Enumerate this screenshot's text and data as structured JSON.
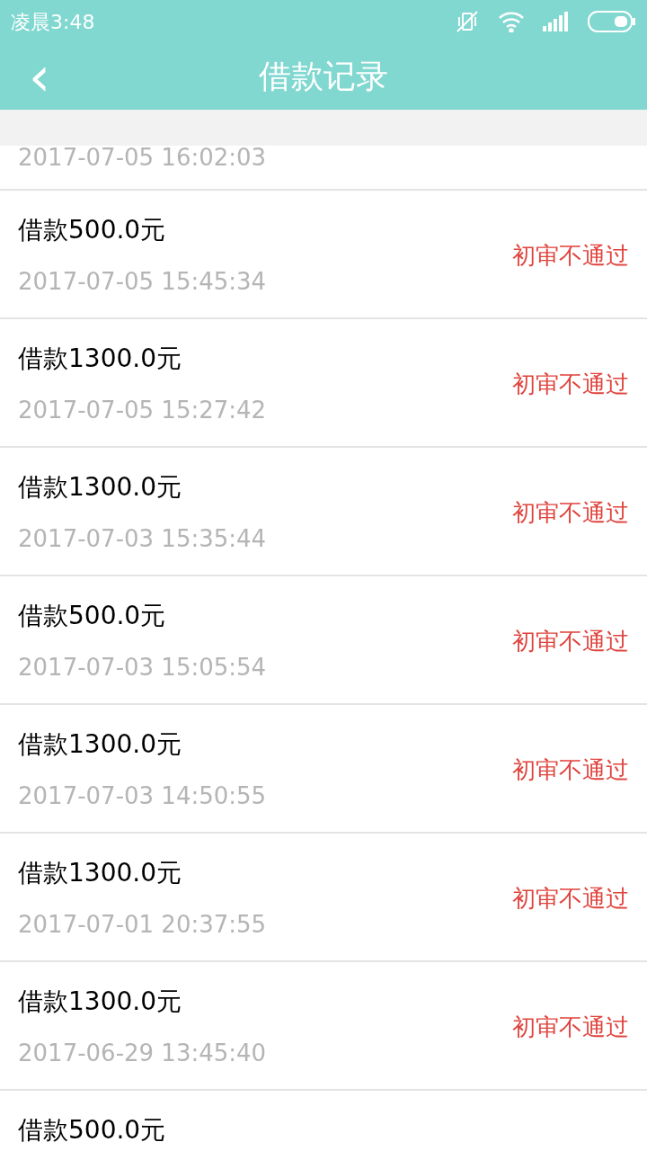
{
  "status_bar": {
    "time": "凌晨3:48"
  },
  "header": {
    "back": "‹",
    "title": "借款记录"
  },
  "partial_record": {
    "time": "2017-07-05 16:02:03"
  },
  "records": [
    {
      "amount": "借款500.0元",
      "time": "2017-07-05 15:45:34",
      "status": "初审不通过"
    },
    {
      "amount": "借款1300.0元",
      "time": "2017-07-05 15:27:42",
      "status": "初审不通过"
    },
    {
      "amount": "借款1300.0元",
      "time": "2017-07-03 15:35:44",
      "status": "初审不通过"
    },
    {
      "amount": "借款500.0元",
      "time": "2017-07-03 15:05:54",
      "status": "初审不通过"
    },
    {
      "amount": "借款1300.0元",
      "time": "2017-07-03 14:50:55",
      "status": "初审不通过"
    },
    {
      "amount": "借款1300.0元",
      "time": "2017-07-01 20:37:55",
      "status": "初审不通过"
    },
    {
      "amount": "借款1300.0元",
      "time": "2017-06-29 13:45:40",
      "status": "初审不通过"
    },
    {
      "amount": "借款500.0元"
    }
  ]
}
